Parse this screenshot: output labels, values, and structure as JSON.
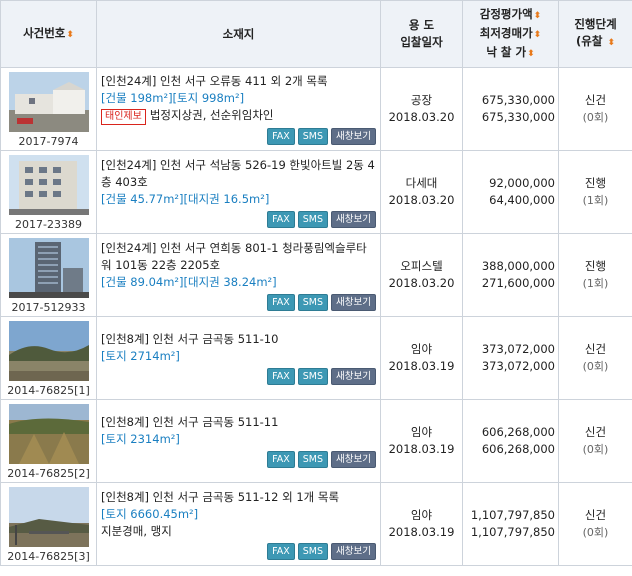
{
  "header": {
    "case_no": "사건번호",
    "location": "소재지",
    "use_line1": "용 도",
    "use_line2": "입찰일자",
    "price_line1": "감정평가액",
    "price_line2": "최저경매가",
    "price_line3": "낙 찰 가",
    "stage_line1": "진행단계",
    "stage_line2": "(유찰",
    "sort_icon": "sort-updown-icon",
    "sort_color": "#e8791a"
  },
  "buttons": {
    "fax": "FAX",
    "sms": "SMS",
    "new_window": "새창보기"
  },
  "rows": [
    {
      "case_no": "2017-7974",
      "address": "[인천24계] 인천 서구 오류동 411 외 2개 목록",
      "area": "[건물 198m²][토지 998m²]",
      "tag": "태인제보",
      "extra": "법정지상권, 선순위임차인",
      "use": "공장",
      "date": "2018.03.20",
      "appraisal": "675,330,000",
      "minimum": "675,330,000",
      "stage": "신건",
      "fail_count": "(0회)"
    },
    {
      "case_no": "2017-23389",
      "address": "[인천24계] 인천 서구 석남동 526-19 한빛아트빌 2동 4층 403호",
      "area": "[건물 45.77m²][대지권 16.5m²]",
      "tag": "",
      "extra": "",
      "use": "다세대",
      "date": "2018.03.20",
      "appraisal": "92,000,000",
      "minimum": "64,400,000",
      "stage": "진행",
      "fail_count": "(1회)"
    },
    {
      "case_no": "2017-512933",
      "address": "[인천24계] 인천 서구 연희동 801-1 청라풍림엑슬루타워 101동 22층 2205호",
      "area": "[건물 89.04m²][대지권 38.24m²]",
      "tag": "",
      "extra": "",
      "use": "오피스텔",
      "date": "2018.03.20",
      "appraisal": "388,000,000",
      "minimum": "271,600,000",
      "stage": "진행",
      "fail_count": "(1회)"
    },
    {
      "case_no": "2014-76825[1]",
      "address": "[인천8계] 인천 서구 금곡동 511-10",
      "area": "[토지 2714m²]",
      "tag": "",
      "extra": "",
      "use": "임야",
      "date": "2018.03.19",
      "appraisal": "373,072,000",
      "minimum": "373,072,000",
      "stage": "신건",
      "fail_count": "(0회)"
    },
    {
      "case_no": "2014-76825[2]",
      "address": "[인천8계] 인천 서구 금곡동 511-11",
      "area": "[토지 2314m²]",
      "tag": "",
      "extra": "",
      "use": "임야",
      "date": "2018.03.19",
      "appraisal": "606,268,000",
      "minimum": "606,268,000",
      "stage": "신건",
      "fail_count": "(0회)"
    },
    {
      "case_no": "2014-76825[3]",
      "address": "[인천8계] 인천 서구 금곡동 511-12 외 1개 목록",
      "area": "[토지 6660.45m²]",
      "tag": "",
      "extra": "지분경매, 맹지",
      "use": "임야",
      "date": "2018.03.19",
      "appraisal": "1,107,797,850",
      "minimum": "1,107,797,850",
      "stage": "신건",
      "fail_count": "(0회)"
    }
  ]
}
